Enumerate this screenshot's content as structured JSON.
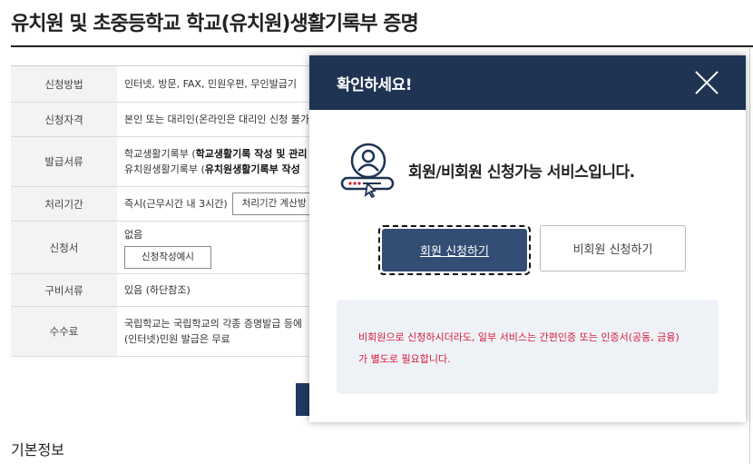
{
  "page": {
    "title": "유치원 및 초중등학교 학교(유치원)생활기록부 증명",
    "section_title": "기본정보"
  },
  "table": {
    "rows": [
      {
        "label": "신청방법",
        "lines": [
          "인터넷, 방문, FAX, 민원우편, 무인발급기"
        ]
      },
      {
        "label": "신청자격",
        "lines": [
          "본인 또는 대리인(온라인은 대리인 신청 불가"
        ]
      },
      {
        "label": "발급서류",
        "line1_prefix": "학교생활기록부 (",
        "line1_bold": "학교생활기록 작성 및 관리",
        "line2_prefix": "유치원생활기록부 (",
        "line2_bold": "유치원생활기록부 작성"
      },
      {
        "label": "처리기간",
        "text": "즉시(근무시간 내 3시간)",
        "button": "처리기간 계산방"
      },
      {
        "label": "신청서",
        "text": "없음",
        "button": "신청작성예시"
      },
      {
        "label": "구비서류",
        "lines": [
          "있음 (하단참조)"
        ]
      },
      {
        "label": "수수료",
        "lines": [
          "국립학교는 국립학교의 각종 증명발급 등에",
          "(인터넷)민원 발급은 무료"
        ]
      }
    ]
  },
  "modal": {
    "title": "확인하세요!",
    "service_text": "회원/비회원 신청가능 서비스입니다.",
    "member_button": "회원 신청하기",
    "guest_button": "비회원 신청하기",
    "notice_line1": "비회원으로 신청하시더라도, 일부 서비스는 간편인증 또는 인증서(공동, 금융)",
    "notice_line2": "가 별도로 필요합니다."
  },
  "colors": {
    "modal_header": "#1f3352",
    "member_button": "#334d74",
    "notice_text": "#d81b3b",
    "notice_bg": "#eef2f7"
  }
}
